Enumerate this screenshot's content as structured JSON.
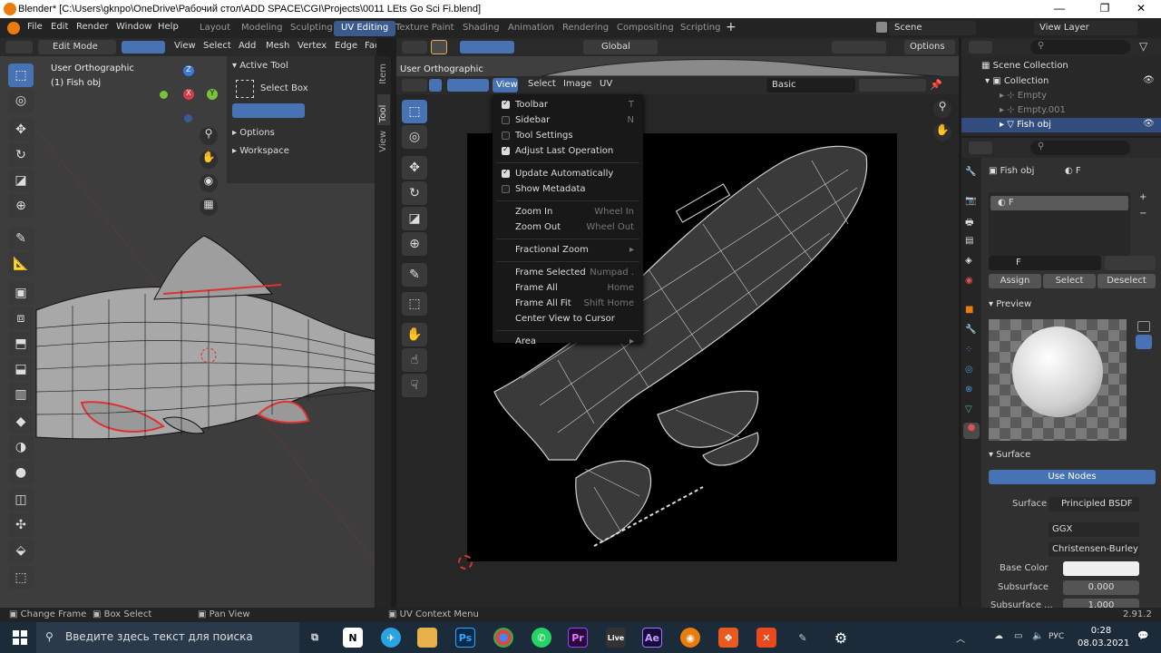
{
  "window": {
    "title": "Blender* [C:\\Users\\gknpo\\OneDrive\\Рабочий стол\\ADD SPACE\\CGI\\Projects\\0011 LEts Go Sci Fi.blend]",
    "controls": [
      "—",
      "❐",
      "✕"
    ]
  },
  "menubar": {
    "items": [
      "File",
      "Edit",
      "Render",
      "Window",
      "Help"
    ],
    "workspaces": [
      "Layout",
      "Modeling",
      "Sculpting",
      "UV Editing",
      "Texture Paint",
      "Shading",
      "Animation",
      "Rendering",
      "Compositing",
      "Scripting"
    ],
    "active_workspace": "UV Editing",
    "add": "+",
    "scene": "Scene",
    "view_layer": "View Layer"
  },
  "viewport3d": {
    "mode": "Edit Mode",
    "menus": [
      "View",
      "Select",
      "Add",
      "Mesh",
      "Vertex",
      "Edge",
      "Face"
    ],
    "overlay_title": "User Orthographic",
    "overlay_object": "(1) Fish obj",
    "gizmo": {
      "z": "Z",
      "x": "X",
      "y": "Y"
    },
    "sidebar_tabs": [
      "Item",
      "Tool",
      "View"
    ],
    "active_tool_label": "Active Tool",
    "tool_name": "Select Box",
    "options": "Options",
    "workspace": "Workspace"
  },
  "uv": {
    "header": {
      "menus": [
        "View",
        "Select",
        "Image",
        "UV"
      ],
      "orientation": "Global",
      "options": "Options",
      "shading": "Basic"
    },
    "overlay_title": "User Orthographic",
    "dropdown": [
      {
        "label": "Toolbar",
        "check": true,
        "shortcut": "T"
      },
      {
        "label": "Sidebar",
        "check": false,
        "shortcut": "N"
      },
      {
        "label": "Tool Settings",
        "check": false,
        "shortcut": ""
      },
      {
        "label": "Adjust Last Operation",
        "check": true,
        "shortcut": ""
      },
      {
        "sep": true
      },
      {
        "label": "Update Automatically",
        "check": true,
        "shortcut": ""
      },
      {
        "label": "Show Metadata",
        "check": false,
        "shortcut": ""
      },
      {
        "sep": true
      },
      {
        "label": "Zoom In",
        "shortcut": "Wheel In"
      },
      {
        "label": "Zoom Out",
        "shortcut": "Wheel Out"
      },
      {
        "sep": true
      },
      {
        "label": "Fractional Zoom",
        "shortcut": "▸"
      },
      {
        "sep": true
      },
      {
        "label": "Frame Selected",
        "shortcut": "Numpad ."
      },
      {
        "label": "Frame All",
        "shortcut": "Home"
      },
      {
        "label": "Frame All Fit",
        "shortcut": "Shift Home"
      },
      {
        "label": "Center View to Cursor",
        "shortcut": ""
      },
      {
        "sep": true
      },
      {
        "label": "Area",
        "shortcut": "▸"
      }
    ]
  },
  "outliner": {
    "items": [
      "Scene Collection",
      "Collection",
      "Empty",
      "Empty.001",
      "Fish obj"
    ]
  },
  "properties": {
    "object": "Fish obj",
    "material": "F",
    "slot": "F",
    "assign": "Assign",
    "select": "Select",
    "deselect": "Deselect",
    "preview": "Preview",
    "surface_panel": "Surface",
    "use_nodes": "Use Nodes",
    "rows": [
      {
        "label": "Surface",
        "value": "Principled BSDF"
      },
      {
        "label": "",
        "value": "GGX"
      },
      {
        "label": "",
        "value": "Christensen-Burley"
      },
      {
        "label": "Base Color",
        "value": ""
      },
      {
        "label": "Subsurface",
        "value": "0.000"
      },
      {
        "label": "Subsurface ...",
        "value": "1.000"
      }
    ]
  },
  "statusbar": {
    "left": [
      "Change Frame",
      "Box Select",
      "Pan View"
    ],
    "mid": "UV Context Menu",
    "version": "2.91.2"
  },
  "taskbar": {
    "search": "Введите здесь текст для поиска",
    "time": "0:28",
    "date": "08.03.2021",
    "lang": "РУС",
    "apps": [
      "N",
      "Ps",
      "Pr",
      "Live",
      "Ae"
    ]
  },
  "colors": {
    "accent": "#4772b3",
    "active_ws": "#3b5b8e",
    "red_edge": "#e03030"
  }
}
